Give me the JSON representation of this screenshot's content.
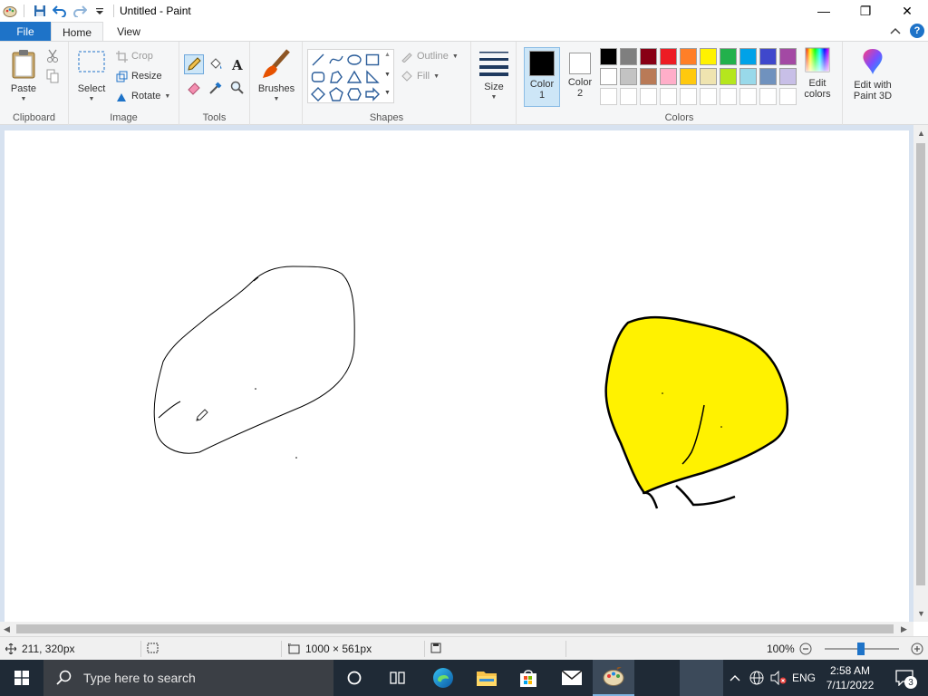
{
  "window": {
    "title": "Untitled - Paint",
    "minimize": "—",
    "maximize": "❐",
    "close": "✕"
  },
  "tabs": {
    "file": "File",
    "home": "Home",
    "view": "View"
  },
  "ribbon": {
    "clipboard": {
      "group": "Clipboard",
      "paste": "Paste"
    },
    "image": {
      "group": "Image",
      "select": "Select",
      "crop": "Crop",
      "resize": "Resize",
      "rotate": "Rotate"
    },
    "tools": {
      "group": "Tools"
    },
    "brushes": {
      "label": "Brushes"
    },
    "shapes": {
      "group": "Shapes",
      "outline": "Outline",
      "fill": "Fill"
    },
    "size": {
      "label": "Size"
    },
    "colors": {
      "group": "Colors",
      "color1": "Color",
      "color1_num": "1",
      "color2": "Color",
      "color2_num": "2",
      "color1_value": "#000000",
      "color2_value": "#ffffff",
      "edit_colors_1": "Edit",
      "edit_colors_2": "colors",
      "paint3d_1": "Edit with",
      "paint3d_2": "Paint 3D",
      "palette_row1": [
        "#000000",
        "#7f7f7f",
        "#880015",
        "#ed1c24",
        "#ff7f27",
        "#fff200",
        "#22b14c",
        "#00a2e8",
        "#3f48cc",
        "#a349a4"
      ],
      "palette_row2": [
        "#ffffff",
        "#c3c3c3",
        "#b97a57",
        "#ffaec9",
        "#ffc90e",
        "#efe4b0",
        "#b5e61d",
        "#99d9ea",
        "#7092be",
        "#c8bfe7"
      ]
    }
  },
  "status": {
    "cursor_pos": "211, 320px",
    "image_size": "1000 × 561px",
    "zoom": "100%"
  },
  "taskbar": {
    "search_placeholder": "Type here to search",
    "lang": "ENG",
    "time": "2:58 AM",
    "date": "7/11/2022",
    "notifications": "3"
  }
}
